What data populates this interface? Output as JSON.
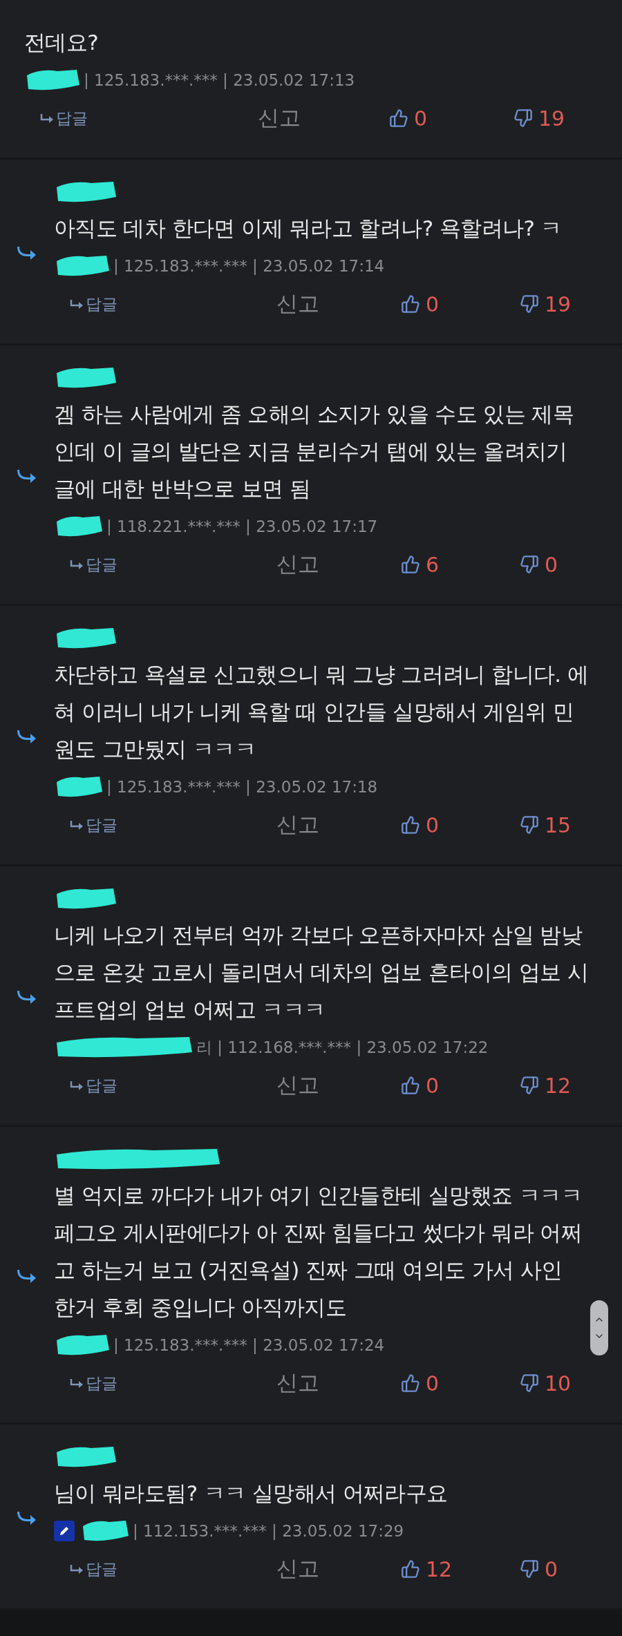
{
  "comments": [
    {
      "kind": "top",
      "text": "전데요?",
      "ip": "| 125.183.***.*** | 23.05.02 17:13",
      "editor_badge": false,
      "reply_label": "답글",
      "report_label": "신고",
      "likes": "0",
      "dislikes": "19"
    },
    {
      "kind": "reply",
      "text": "아직도 데차 한다면 이제 뭐라고 할려나? 욕할려나? ㅋ",
      "ip": "| 125.183.***.*** | 23.05.02 17:14",
      "editor_badge": false,
      "reply_label": "답글",
      "report_label": "신고",
      "likes": "0",
      "dislikes": "19"
    },
    {
      "kind": "reply",
      "text": "겜 하는 사람에게 좀 오해의 소지가 있을 수도 있는 제목인데 이 글의 발단은 지금 분리수거 탭에 있는 올려치기 글에 대한 반박으로 보면 됨",
      "ip": "| 118.221.***.*** | 23.05.02 17:17",
      "editor_badge": false,
      "reply_label": "답글",
      "report_label": "신고",
      "likes": "6",
      "dislikes": "0"
    },
    {
      "kind": "reply",
      "text": "차단하고 욕설로 신고했으니 뭐 그냥 그러려니 합니다. 에혀 이러니 내가 니케 욕할 때 인간들 실망해서 게임위 민원도 그만뒀지 ㅋㅋㅋ",
      "ip": "| 125.183.***.*** | 23.05.02 17:18",
      "editor_badge": false,
      "reply_label": "답글",
      "report_label": "신고",
      "likes": "0",
      "dislikes": "15"
    },
    {
      "kind": "reply",
      "text": "니케 나오기 전부터 억까 각보다 오픈하자마자 삼일 밤낮으로 온갖 고로시 돌리면서 데차의 업보 흔타이의 업보 시프트업의 업보 어쩌고 ㅋㅋㅋ",
      "ip": "리 | 112.168.***.*** | 23.05.02 17:22",
      "editor_badge": false,
      "reply_label": "답글",
      "report_label": "신고",
      "likes": "0",
      "dislikes": "12"
    },
    {
      "kind": "reply",
      "text": "별 억지로 까다가 내가 여기 인간들한테 실망했죠 ㅋㅋㅋ 페그오 게시판에다가 아 진짜 힘들다고 썼다가 뭐라 어쩌고 하는거 보고 (거진욕설) 진짜 그때 여의도 가서 사인 한거 후회 중입니다 아직까지도",
      "ip": "| 125.183.***.*** | 23.05.02 17:24",
      "editor_badge": false,
      "reply_label": "답글",
      "report_label": "신고",
      "likes": "0",
      "dislikes": "10"
    },
    {
      "kind": "reply",
      "text": "님이 뭐라도됨? ㅋㅋ 실망해서 어쩌라구요",
      "ip": "| 112.153.***.*** | 23.05.02 17:29",
      "editor_badge": true,
      "reply_label": "답글",
      "report_label": "신고",
      "likes": "12",
      "dislikes": "0"
    }
  ]
}
